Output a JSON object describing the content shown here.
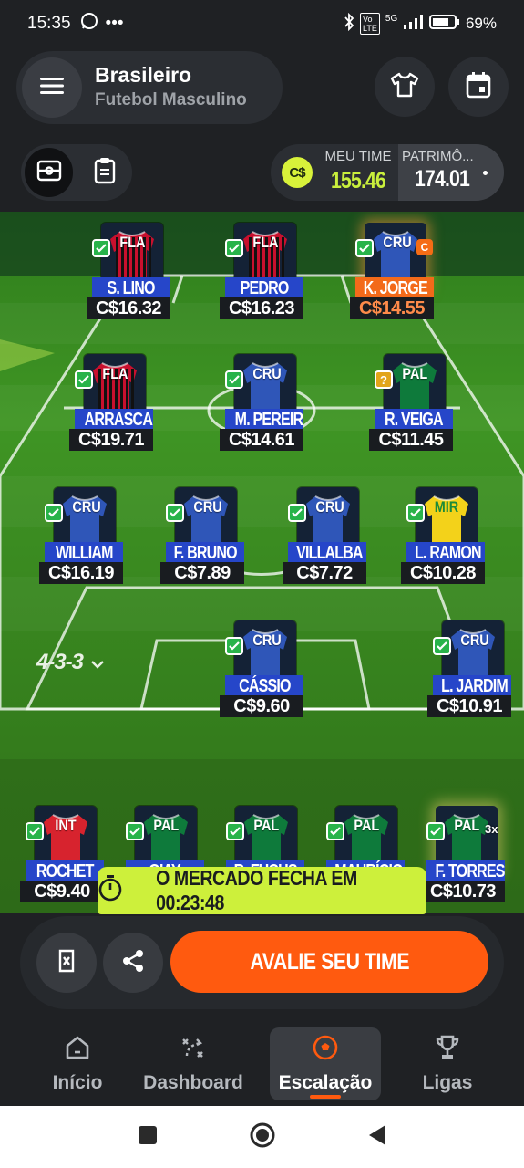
{
  "status_bar": {
    "time": "15:35",
    "battery": "69%",
    "network": "5G"
  },
  "header": {
    "title": "Brasileiro",
    "subtitle": "Futebol Masculino"
  },
  "budget": {
    "currency_icon": "C$",
    "team_label": "MEU TIME",
    "team_value": "155.46",
    "patrimony_label": "PATRIMÔ...",
    "patrimony_value": "174.01"
  },
  "formation": "4-3-3",
  "players": [
    {
      "name": "S. LINO",
      "price": "C$16.32",
      "club": "FLA",
      "kit": "fla"
    },
    {
      "name": "PEDRO",
      "price": "C$16.23",
      "club": "FLA",
      "kit": "fla"
    },
    {
      "name": "K. JORGE",
      "price": "C$14.55",
      "club": "CRU",
      "kit": "cru",
      "captain": "C"
    },
    {
      "name": "ARRASCA...",
      "price": "C$19.71",
      "club": "FLA",
      "kit": "fla"
    },
    {
      "name": "M. PEREIRA",
      "price": "C$14.61",
      "club": "CRU",
      "kit": "cru"
    },
    {
      "name": "R. VEIGA",
      "price": "C$11.45",
      "club": "PAL",
      "kit": "pal",
      "status": "?"
    },
    {
      "name": "WILLIAM",
      "price": "C$16.19",
      "club": "CRU",
      "kit": "cru"
    },
    {
      "name": "F. BRUNO",
      "price": "C$7.89",
      "club": "CRU",
      "kit": "cru"
    },
    {
      "name": "VILLALBA",
      "price": "C$7.72",
      "club": "CRU",
      "kit": "cru"
    },
    {
      "name": "L. RAMON",
      "price": "C$10.28",
      "club": "MIR",
      "kit": "mir"
    },
    {
      "name": "CÁSSIO",
      "price": "C$9.60",
      "club": "CRU",
      "kit": "cru"
    },
    {
      "name": "L. JARDIM",
      "price": "C$10.91",
      "club": "CRU",
      "kit": "cru"
    },
    {
      "name": "ROCHET",
      "price": "C$9.40",
      "club": "INT",
      "kit": "int"
    },
    {
      "name": "GIAY",
      "price": "",
      "club": "PAL",
      "kit": "pal"
    },
    {
      "name": "R. FUCHS",
      "price": "",
      "club": "PAL",
      "kit": "pal"
    },
    {
      "name": "MAURÍCIO",
      "price": "",
      "club": "PAL",
      "kit": "pal"
    },
    {
      "name": "F. TORRES",
      "price": "C$10.73",
      "club": "PAL",
      "kit": "pal",
      "extra": "3x"
    }
  ],
  "timer": {
    "label": "O MERCADO FECHA EM 00:23:48"
  },
  "actions": {
    "evaluate_label": "AVALIE SEU TIME"
  },
  "nav": {
    "items": [
      {
        "label": "Início"
      },
      {
        "label": "Dashboard"
      },
      {
        "label": "Escalação"
      },
      {
        "label": "Ligas"
      }
    ]
  },
  "colors": {
    "accent": "#ff5a0f",
    "lime": "#cdf03b",
    "name_tag": "#2646c9",
    "captain": "#f36a1a"
  }
}
